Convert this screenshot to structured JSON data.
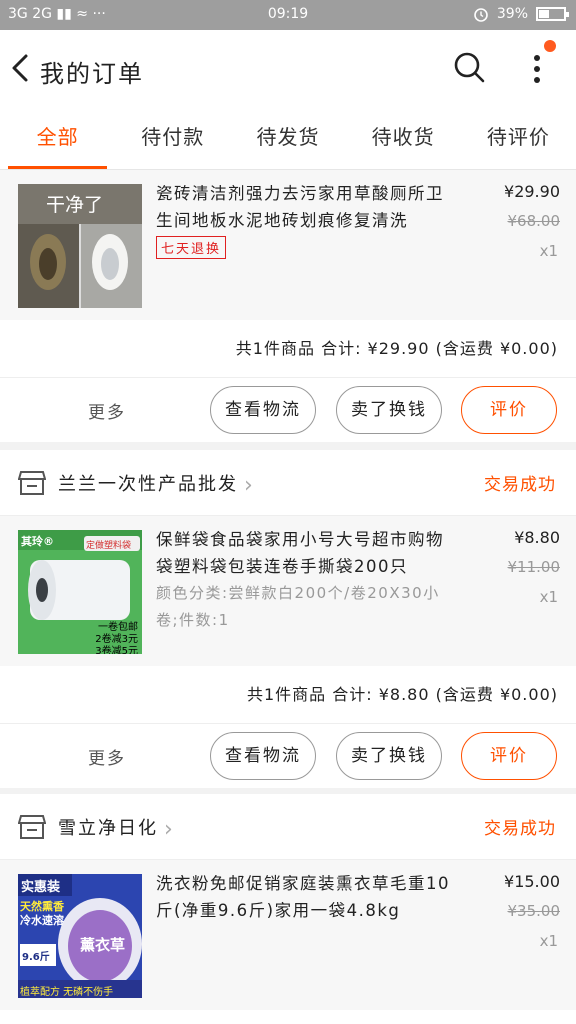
{
  "status_bar": {
    "left": "3G 2G ▮▮ ≈ ···",
    "time": "09:19",
    "battery": "39%",
    "battery_level": 0.39
  },
  "header": {
    "title": "我的订单"
  },
  "tabs": [
    "全部",
    "待付款",
    "待发货",
    "待收货",
    "待评价"
  ],
  "colors": {
    "accent": "#ff5000",
    "return_tag": "#e02020"
  },
  "orders": [
    {
      "item": {
        "thumb_text": "干净了",
        "title": "瓷砖清洁剂强力去污家用草酸厕所卫生间地板水泥地砖划痕修复清洗",
        "tag": "七天退换",
        "price": "¥29.90",
        "orig_price": "¥68.00",
        "qty": "x1"
      },
      "summary": "共1件商品  合计: ¥29.90 (含运费 ¥0.00)",
      "actions": {
        "more": "更多",
        "logistics": "查看物流",
        "sell": "卖了换钱",
        "review": "评价"
      }
    },
    {
      "shop": "兰兰一次性产品批发",
      "status": "交易成功",
      "item": {
        "thumb_brand": "其玲®",
        "thumb_badge": "定做塑料袋",
        "thumb_promo1": "一卷包邮",
        "thumb_promo2": "2卷减3元",
        "thumb_promo3": "3卷减5元",
        "title": "保鲜袋食品袋家用小号大号超市购物袋塑料袋包装连卷手撕袋200只",
        "sku": "颜色分类:尝鲜款白200个/卷20X30小卷;件数:1",
        "price": "¥8.80",
        "orig_price": "¥11.00",
        "qty": "x1"
      },
      "summary": "共1件商品  合计: ¥8.80 (含运费 ¥0.00)",
      "actions": {
        "more": "更多",
        "logistics": "查看物流",
        "sell": "卖了换钱",
        "review": "评价"
      }
    },
    {
      "shop": "雪立净日化",
      "status": "交易成功",
      "item": {
        "thumb_badge": "实惠装",
        "thumb_line1": "天然熏香",
        "thumb_line2": "冷水速溶",
        "thumb_product": "薰衣草",
        "thumb_weight": "9.6斤",
        "thumb_footer": "植萃配方 无磷不伤手",
        "title": "洗衣粉免邮促销家庭装熏衣草毛重10斤(净重9.6斤)家用一袋4.8kg",
        "price": "¥15.00",
        "orig_price": "¥35.00",
        "qty": "x1"
      }
    }
  ]
}
